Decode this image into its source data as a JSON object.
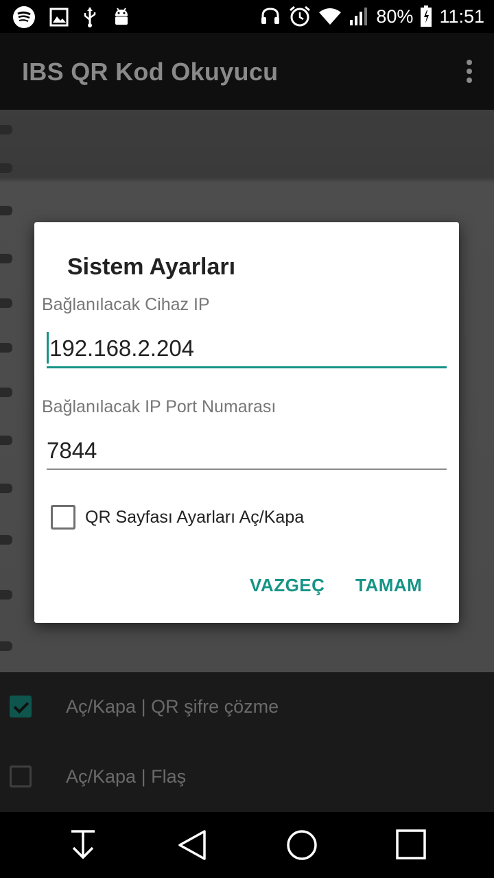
{
  "status_bar": {
    "battery": "80%",
    "time": "11:51",
    "icons_left": [
      "spotify-icon",
      "image-icon",
      "usb-icon",
      "android-debug-icon"
    ],
    "icons_right": [
      "headset-icon",
      "alarm-icon",
      "wifi-icon",
      "signal-icon",
      "battery-icon"
    ]
  },
  "app_bar": {
    "title": "IBS QR Kod Okuyucu",
    "menu_icon": "overflow-menu-icon"
  },
  "bottom_options": [
    {
      "label": "Aç/Kapa | QR şifre çözme",
      "checked": true
    },
    {
      "label": "Aç/Kapa | Flaş",
      "checked": false
    }
  ],
  "dialog": {
    "title": "Sistem Ayarları",
    "ip_label": "Bağlanılacak Cihaz IP",
    "ip_value": "192.168.2.204",
    "port_label": "Bağlanılacak IP Port Numarası",
    "port_value": "7844",
    "checkbox_label": "QR Sayfası Ayarları Aç/Kapa",
    "checkbox_checked": false,
    "cancel_label": "VAZGEÇ",
    "ok_label": "TAMAM"
  },
  "nav_bar": {
    "icons": [
      "hide-keyboard-icon",
      "back-icon",
      "home-icon",
      "recents-icon"
    ]
  },
  "colors": {
    "accent": "#159386",
    "dialog_bg": "#ffffff",
    "status_bar_bg": "#000000"
  }
}
